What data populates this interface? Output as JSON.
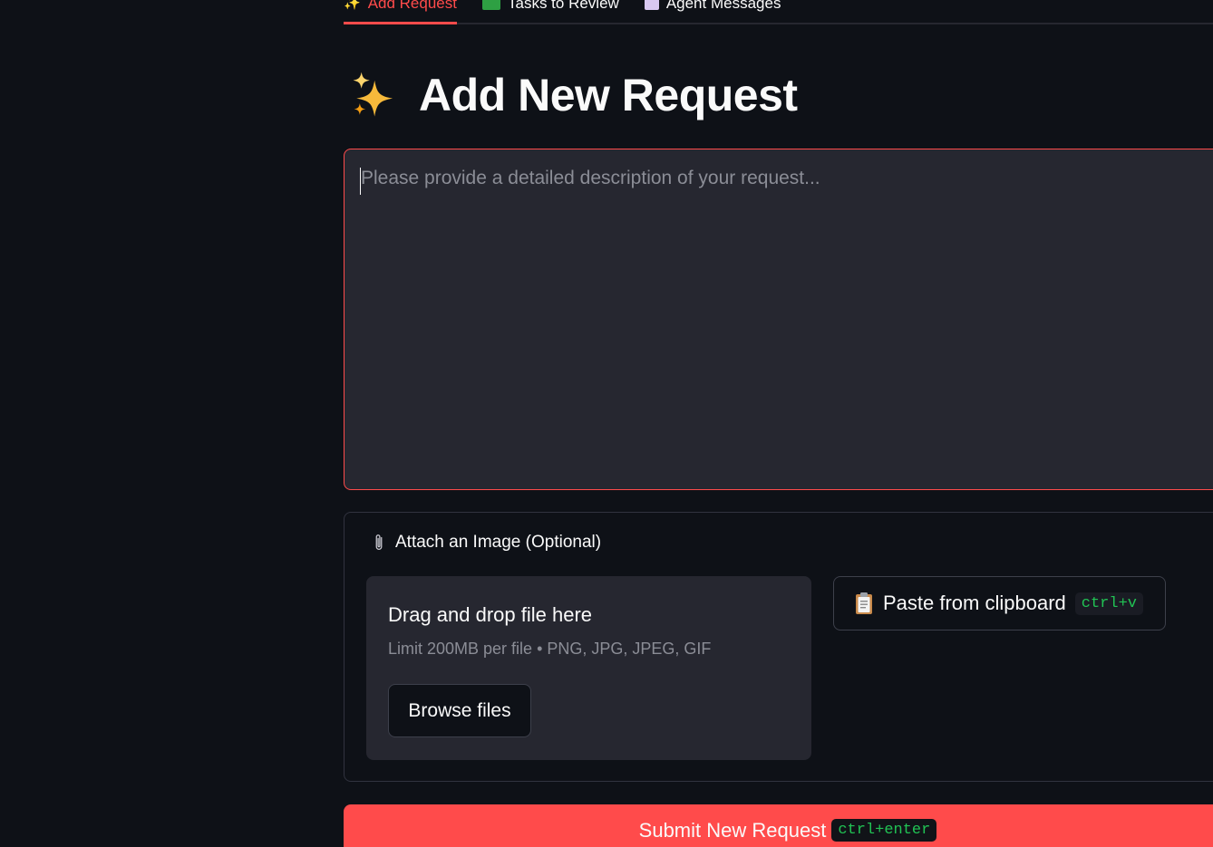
{
  "tabs": [
    {
      "label": "Add Request",
      "icon": "sparkles-icon",
      "active": true
    },
    {
      "label": "Tasks to Review",
      "icon": "green-check-icon",
      "active": false
    },
    {
      "label": "Agent Messages",
      "icon": "memo-icon",
      "active": false
    }
  ],
  "title": {
    "icon": "sparkles-icon",
    "text": "Add New Request"
  },
  "request": {
    "placeholder": "Please provide a detailed description of your request...",
    "value": ""
  },
  "attach": {
    "label": "Attach an Image (Optional)",
    "icon": "paperclip-icon",
    "dropzone_title": "Drag and drop file here",
    "dropzone_limit": "Limit 200MB per file • PNG, JPG, JPEG, GIF",
    "browse_label": "Browse files",
    "paste_label": "Paste from clipboard",
    "paste_icon": "clipboard-icon",
    "paste_shortcut": "ctrl+v"
  },
  "submit": {
    "label": "Submit New Request",
    "shortcut": "ctrl+enter"
  },
  "colors": {
    "background": "#0e1117",
    "accent": "#ff4b4b",
    "surface": "#262730",
    "shortcut_text": "#21c354"
  }
}
